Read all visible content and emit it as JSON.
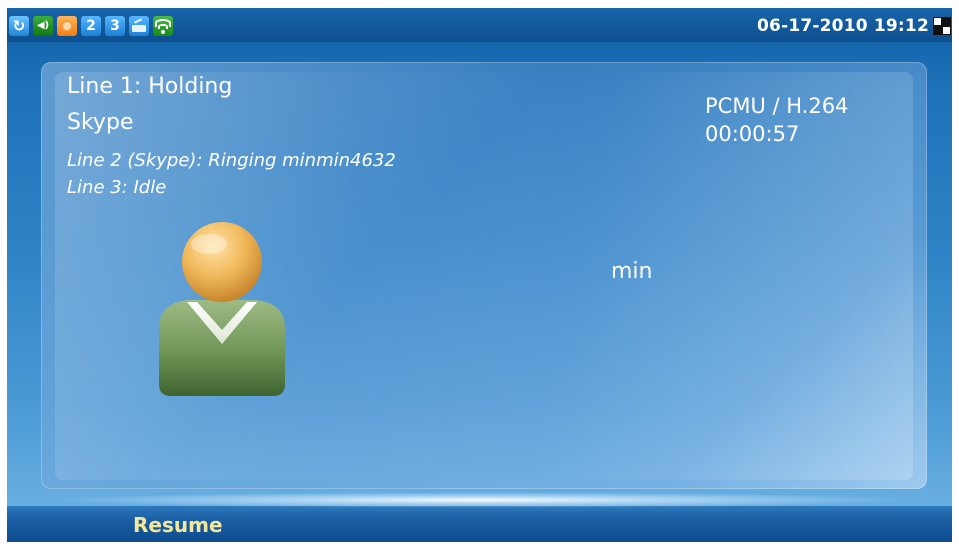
{
  "status_bar": {
    "icons": [
      {
        "name": "sync-icon",
        "glyph": "↻"
      },
      {
        "name": "speaker-icon",
        "glyph": "◀)"
      },
      {
        "name": "hold-icon",
        "glyph": ""
      },
      {
        "name": "line-2-icon",
        "glyph": "2"
      },
      {
        "name": "line-3-icon",
        "glyph": "3"
      },
      {
        "name": "network-icon",
        "glyph": ""
      },
      {
        "name": "wifi-icon",
        "glyph": ""
      }
    ],
    "datetime": "06-17-2010 19:12"
  },
  "call": {
    "line1_status": "Line 1: Holding",
    "line1_account": "Skype",
    "line2_status": "Line 2 (Skype): Ringing minmin4632",
    "line3_status": "Line 3: Idle",
    "codec": "PCMU / H.264",
    "duration": "00:00:57",
    "contact_name": "min"
  },
  "softkeys": {
    "resume_label": "Resume"
  },
  "colors": {
    "background": "#2e83c6",
    "status_bar": "#0d4f8f",
    "softkey_text": "#f5e79a",
    "text": "#ffffff"
  }
}
